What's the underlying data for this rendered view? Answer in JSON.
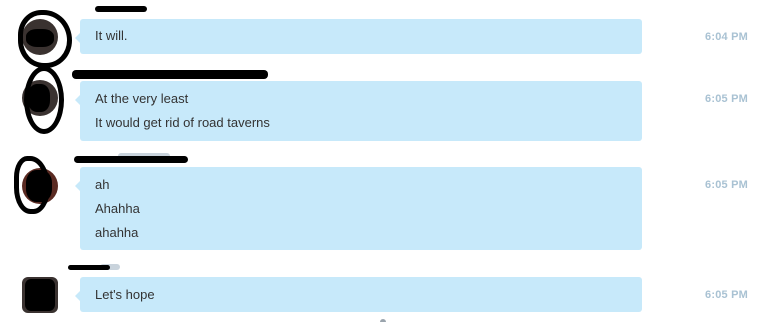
{
  "conversation": {
    "messages": [
      {
        "lines": [
          "It will."
        ],
        "time": "6:04 PM"
      },
      {
        "lines": [
          "At the very least",
          "It would get rid of road taverns"
        ],
        "time": "6:05 PM"
      },
      {
        "lines": [
          "ah",
          "Ahahha",
          "ahahha"
        ],
        "time": "6:05 PM"
      },
      {
        "lines": [
          "Let's hope"
        ],
        "time": "6:05 PM"
      }
    ]
  },
  "colors": {
    "bubble": "#c7e9fa",
    "timestamp": "#a9c2d3",
    "redaction": "#000000"
  }
}
